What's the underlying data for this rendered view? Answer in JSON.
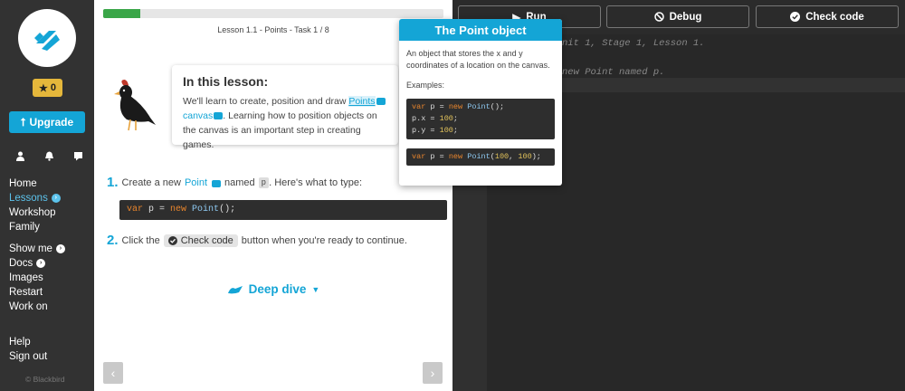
{
  "sidebar": {
    "stars": "0",
    "upgrade_label": "Upgrade",
    "nav_main": [
      {
        "label": "Home",
        "active": false
      },
      {
        "label": "Lessons",
        "active": true
      },
      {
        "label": "Workshop",
        "active": false
      },
      {
        "label": "Family",
        "active": false
      }
    ],
    "nav_secondary": [
      {
        "label": "Show me"
      },
      {
        "label": "Docs"
      },
      {
        "label": "Images"
      },
      {
        "label": "Restart"
      },
      {
        "label": "Work on"
      }
    ],
    "nav_footer": [
      {
        "label": "Help"
      },
      {
        "label": "Sign out"
      }
    ],
    "copyright": "© Blackbird"
  },
  "lesson": {
    "progress_fraction": 0.11,
    "task_label": "Lesson 1.1 - Points - Task 1 / 8",
    "callout_title": "In this lesson:",
    "callout_text_1": "We'll learn to create, position and draw ",
    "callout_link_points": "Points",
    "callout_link_canvas": "canvas",
    "callout_text_2": ". Learning how to position objects on the canvas is an important step in creating games.",
    "step1_num": "1.",
    "step1_pre": "Create a new",
    "step1_link": "Point",
    "step1_mid": "named",
    "step1_code": "p",
    "step1_post": ". Here's what to type:",
    "code_kw1": "var",
    "code_mid": " p = ",
    "code_kw2": "new",
    "code_fn": " Point",
    "code_end": "();",
    "step2_num": "2.",
    "step2_pre": "Click the",
    "step2_button": "Check code",
    "step2_post": "button when you're ready to continue.",
    "deep_dive": "Deep dive"
  },
  "toolbar": {
    "run_label": "Run",
    "debug_label": "Debug",
    "check_label": "Check code"
  },
  "editor": {
    "comment_1": "nit 1, Stage 1, Lesson 1.",
    "comment_2": "new Point named p."
  },
  "tooltip": {
    "title": "The Point object",
    "description": "An object that stores the x and y coordinates of a location on the canvas.",
    "examples_label": "Examples:",
    "ex1_l1_kw": "var",
    "ex1_l1_a": " p = ",
    "ex1_l1_kw2": "new",
    "ex1_l1_fn": " Point",
    "ex1_l1_end": "();",
    "ex1_l2_a": "p.x = ",
    "ex1_l2_num": "100",
    "ex1_l3_a": "p.y = ",
    "ex1_l3_num": "100",
    "semicolon": ";",
    "ex2_kw": "var",
    "ex2_a": " p = ",
    "ex2_kw2": "new",
    "ex2_fn": " Point",
    "ex2_open": "(",
    "ex2_n1": "100",
    "ex2_comma": ", ",
    "ex2_n2": "100",
    "ex2_close": ");"
  }
}
